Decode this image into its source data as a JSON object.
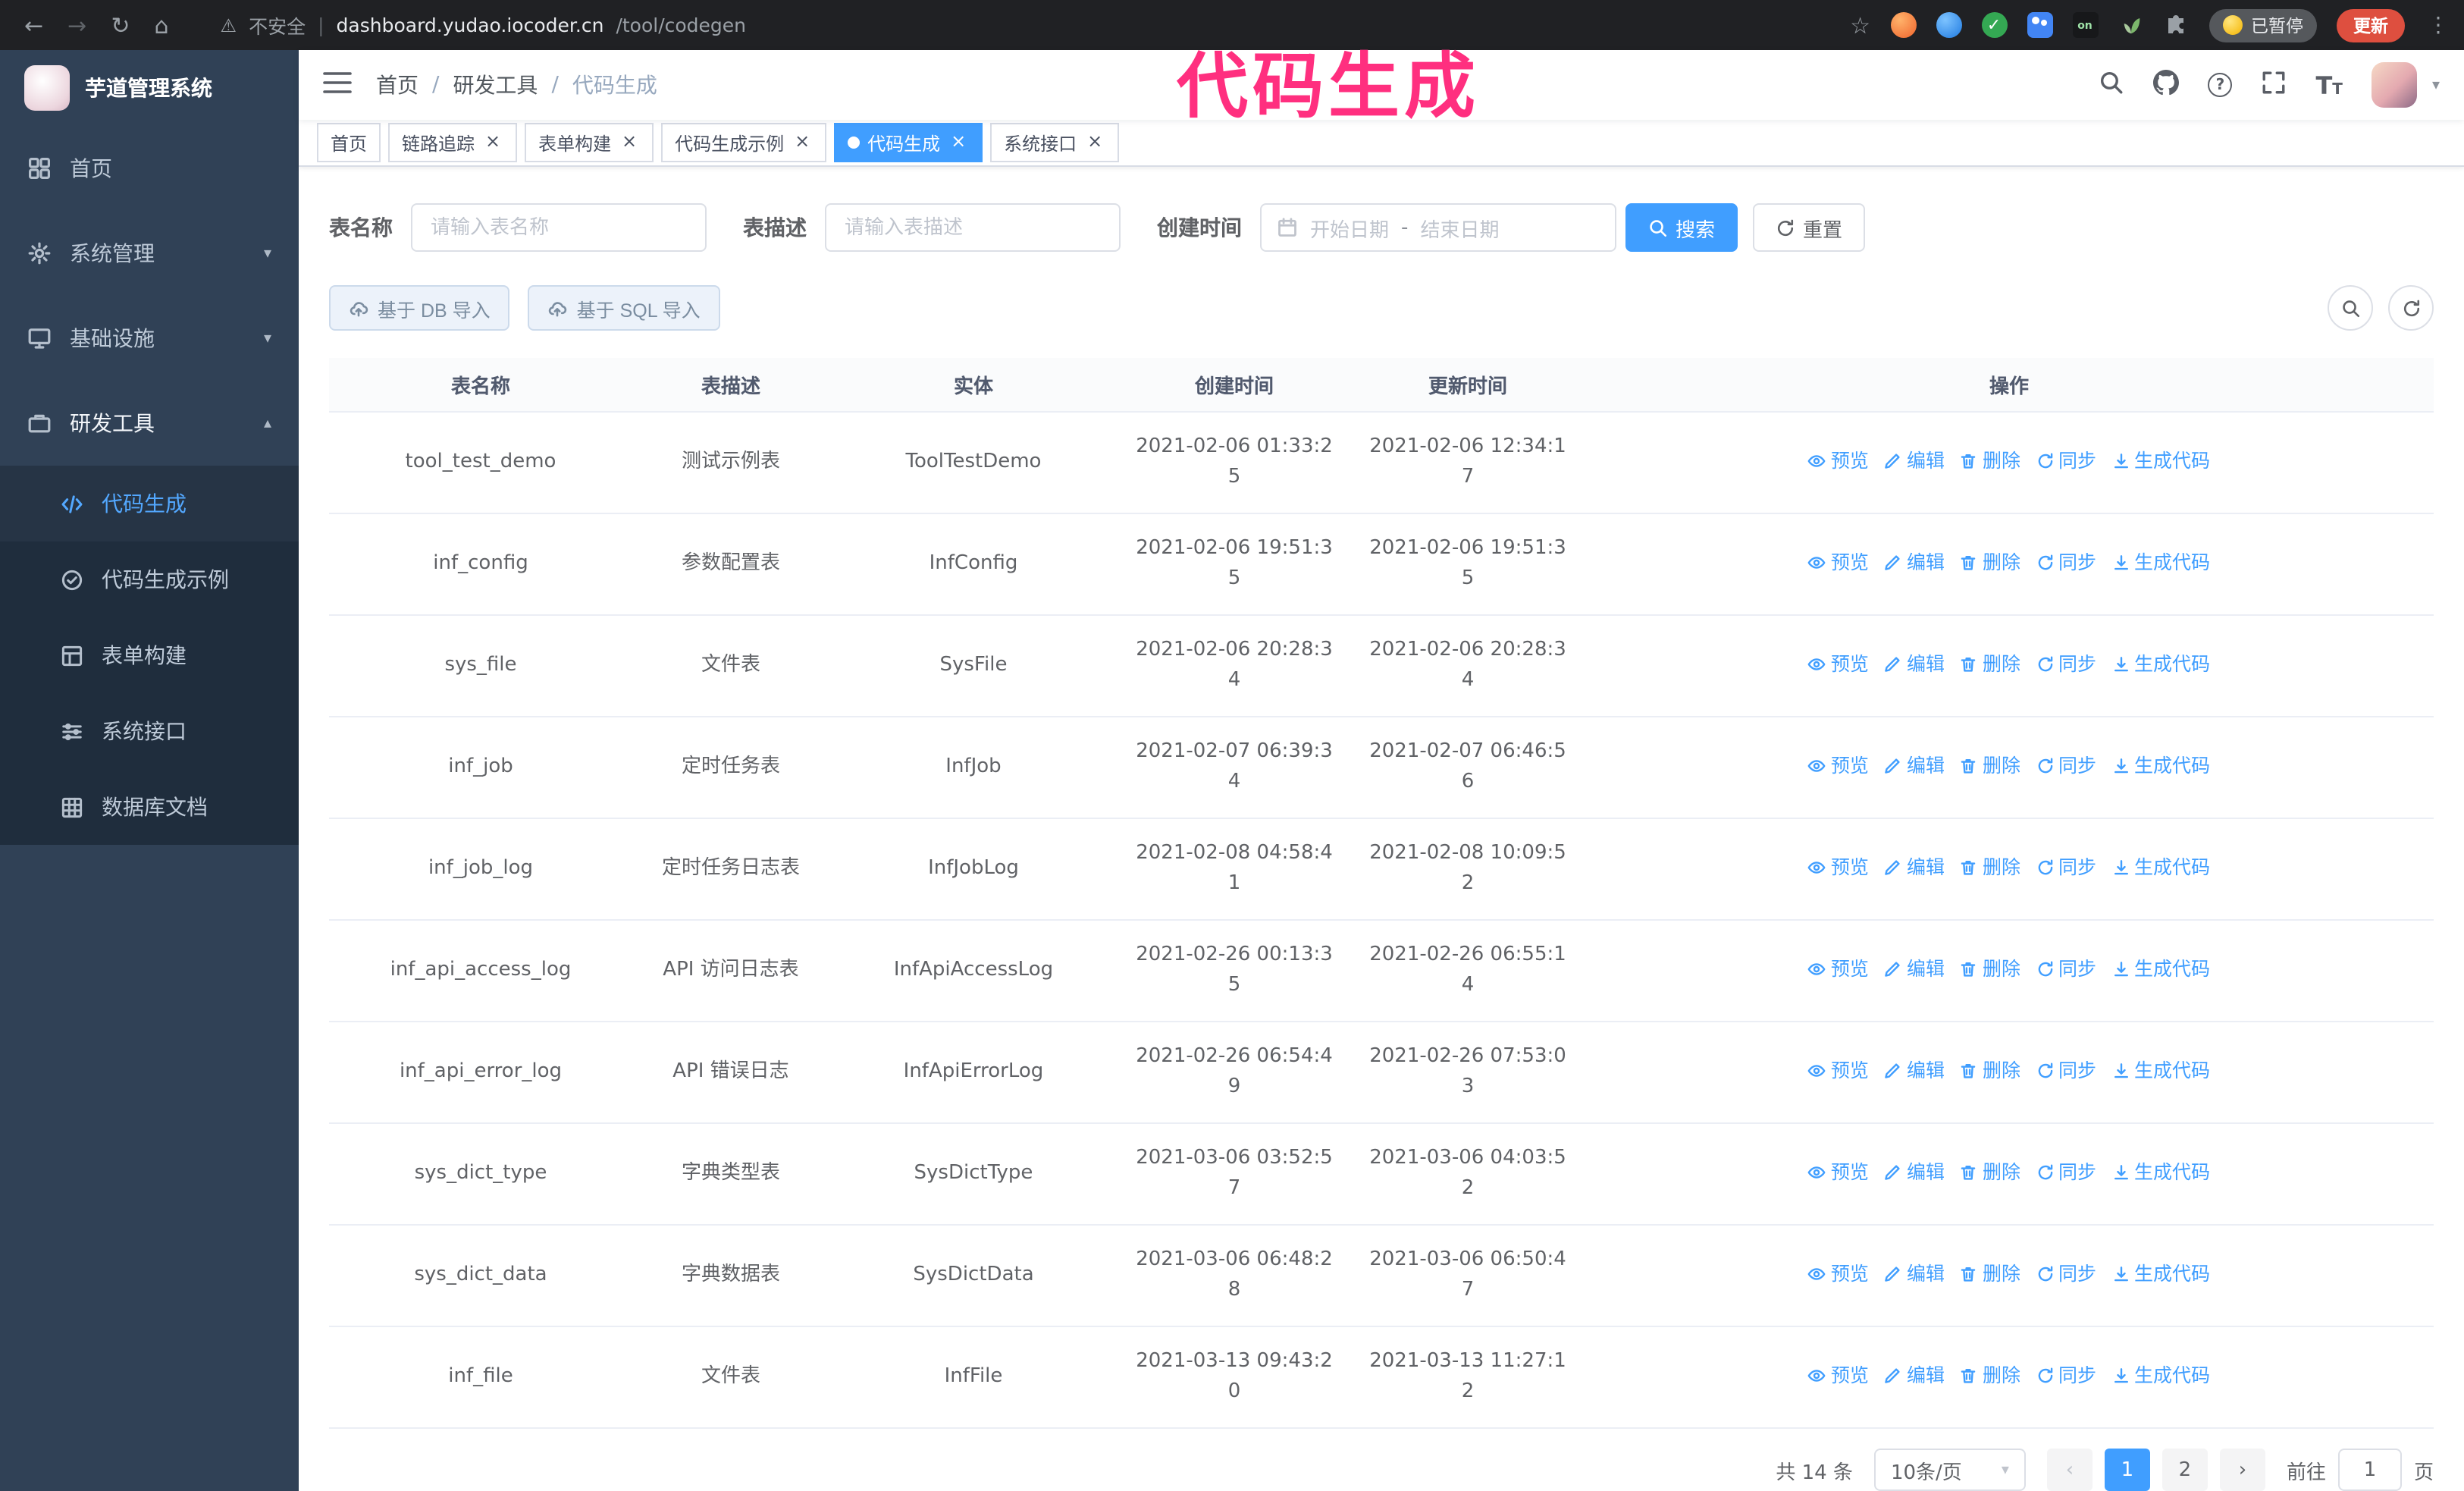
{
  "annotation": {
    "text": "代码生成",
    "color": "#ff2f7f"
  },
  "browser": {
    "security_label": "不安全",
    "url_divider": "|",
    "url_host": "dashboard.yudao.iocoder.cn",
    "url_path": "/tool/codegen",
    "paused_badge": "已暂停",
    "update_button": "更新",
    "extension_on_badge": "on",
    "icons": {
      "back": "←",
      "forward": "→",
      "reload": "↻",
      "home": "⌂",
      "warning": "⚠",
      "bookmark": "☆",
      "menu": "⋮",
      "check": "✓"
    }
  },
  "sidebar": {
    "logo_title": "芋道管理系统",
    "chevron_down": "▾",
    "chevron_up": "▴",
    "items": [
      {
        "label": "首页"
      },
      {
        "label": "系统管理"
      },
      {
        "label": "基础设施"
      },
      {
        "label": "研发工具"
      }
    ],
    "sub_items": [
      {
        "label": "代码生成",
        "active": true
      },
      {
        "label": "代码生成示例",
        "active": false
      },
      {
        "label": "表单构建",
        "active": false
      },
      {
        "label": "系统接口",
        "active": false
      },
      {
        "label": "数据库文档",
        "active": false
      }
    ]
  },
  "header": {
    "breadcrumb": [
      "首页",
      "研发工具",
      "代码生成"
    ],
    "breadcrumb_separator": "/",
    "help_glyph": "?",
    "caret": "▾",
    "text_size_glyph": "T"
  },
  "tabs": {
    "close_glyph": "×",
    "items": [
      {
        "label": "首页",
        "closable": false,
        "active": false
      },
      {
        "label": "链路追踪",
        "closable": true,
        "active": false
      },
      {
        "label": "表单构建",
        "closable": true,
        "active": false
      },
      {
        "label": "代码生成示例",
        "closable": true,
        "active": false
      },
      {
        "label": "代码生成",
        "closable": true,
        "active": true
      },
      {
        "label": "系统接口",
        "closable": true,
        "active": false
      }
    ]
  },
  "filters": {
    "table_name_label": "表名称",
    "table_name_placeholder": "请输入表名称",
    "table_desc_label": "表描述",
    "table_desc_placeholder": "请输入表描述",
    "create_time_label": "创建时间",
    "start_date_placeholder": "开始日期",
    "date_separator": "-",
    "end_date_placeholder": "结束日期",
    "search_button": "搜索",
    "reset_button": "重置"
  },
  "toolbar": {
    "import_db_label": "基于 DB 导入",
    "import_sql_label": "基于 SQL 导入"
  },
  "table": {
    "columns": [
      "表名称",
      "表描述",
      "实体",
      "创建时间",
      "更新时间",
      "操作"
    ],
    "actions": [
      {
        "label": "预览",
        "icon": "eye-icon"
      },
      {
        "label": "编辑",
        "icon": "edit-icon"
      },
      {
        "label": "删除",
        "icon": "delete-icon"
      },
      {
        "label": "同步",
        "icon": "sync-icon"
      },
      {
        "label": "生成代码",
        "icon": "download-icon"
      }
    ],
    "rows": [
      {
        "name": "tool_test_demo",
        "desc": "测试示例表",
        "entity": "ToolTestDemo",
        "create_time": "2021-02-06 01:33:25",
        "update_time": "2021-02-06 12:34:17"
      },
      {
        "name": "inf_config",
        "desc": "参数配置表",
        "entity": "InfConfig",
        "create_time": "2021-02-06 19:51:35",
        "update_time": "2021-02-06 19:51:35"
      },
      {
        "name": "sys_file",
        "desc": "文件表",
        "entity": "SysFile",
        "create_time": "2021-02-06 20:28:34",
        "update_time": "2021-02-06 20:28:34"
      },
      {
        "name": "inf_job",
        "desc": "定时任务表",
        "entity": "InfJob",
        "create_time": "2021-02-07 06:39:34",
        "update_time": "2021-02-07 06:46:56"
      },
      {
        "name": "inf_job_log",
        "desc": "定时任务日志表",
        "entity": "InfJobLog",
        "create_time": "2021-02-08 04:58:41",
        "update_time": "2021-02-08 10:09:52"
      },
      {
        "name": "inf_api_access_log",
        "desc": "API 访问日志表",
        "entity": "InfApiAccessLog",
        "create_time": "2021-02-26 00:13:35",
        "update_time": "2021-02-26 06:55:14"
      },
      {
        "name": "inf_api_error_log",
        "desc": "API 错误日志",
        "entity": "InfApiErrorLog",
        "create_time": "2021-02-26 06:54:49",
        "update_time": "2021-02-26 07:53:03"
      },
      {
        "name": "sys_dict_type",
        "desc": "字典类型表",
        "entity": "SysDictType",
        "create_time": "2021-03-06 03:52:57",
        "update_time": "2021-03-06 04:03:52"
      },
      {
        "name": "sys_dict_data",
        "desc": "字典数据表",
        "entity": "SysDictData",
        "create_time": "2021-03-06 06:48:28",
        "update_time": "2021-03-06 06:50:47"
      },
      {
        "name": "inf_file",
        "desc": "文件表",
        "entity": "InfFile",
        "create_time": "2021-03-13 09:43:20",
        "update_time": "2021-03-13 11:27:12"
      }
    ]
  },
  "pagination": {
    "total_text": "共 14 条",
    "page_size_label": "10条/页",
    "caret": "▾",
    "prev_glyph": "‹",
    "next_glyph": "›",
    "pages": [
      "1",
      "2"
    ],
    "active_page": "1",
    "goto_label": "前往",
    "goto_value": "1",
    "goto_suffix": "页"
  }
}
